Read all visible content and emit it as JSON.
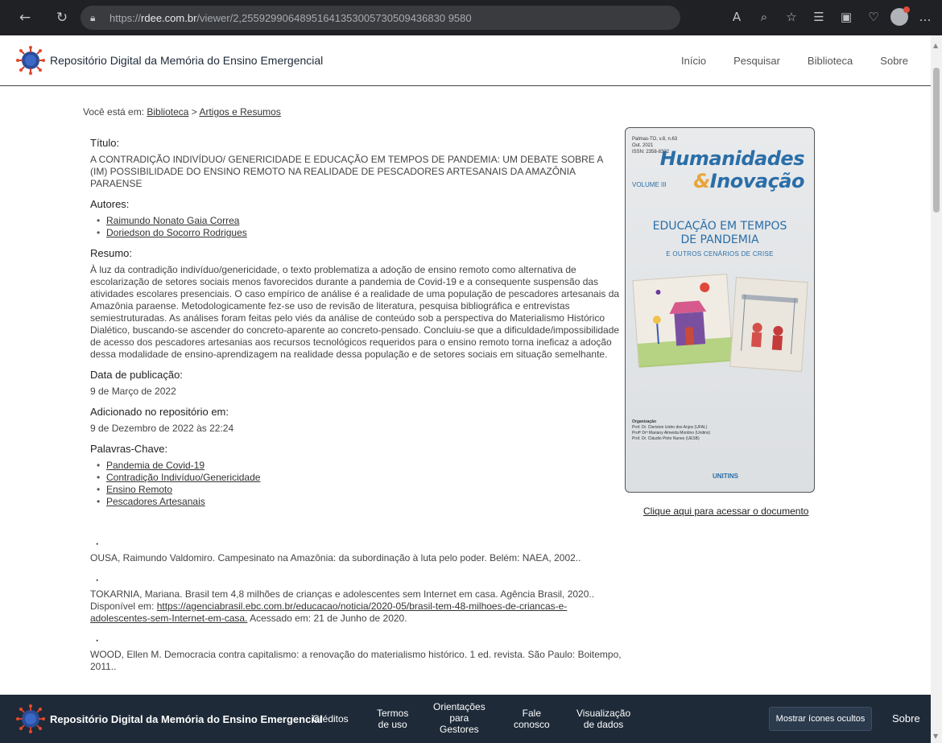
{
  "browser": {
    "url_prefix": "https://",
    "url_host": "rdee.com.br",
    "url_path": "/viewer/2,25592990648951641353005730509436830 9580"
  },
  "header": {
    "site_title": "Repositório Digital da Memória do Ensino Emergencial",
    "nav": [
      "Início",
      "Pesquisar",
      "Biblioteca",
      "Sobre"
    ]
  },
  "breadcrumb": {
    "prefix": "Você está em:",
    "biblioteca": "Biblioteca",
    "separator": ">",
    "current": "Artigos e Resumos"
  },
  "record": {
    "title_label": "Título:",
    "title": "A CONTRADIÇÃO INDIVÍDUO/ GENERICIDADE E EDUCAÇÃO EM TEMPOS DE PANDEMIA: UM DEBATE SOBRE A (IM) POSSIBILIDADE DO ENSINO REMOTO NA REALIDADE DE PESCADORES ARTESANAIS DA AMAZÔNIA PARAENSE",
    "authors_label": "Autores:",
    "authors": [
      "Raimundo Nonato Gaia Correa",
      "Doriedson do Socorro Rodrigues"
    ],
    "abstract_label": "Resumo:",
    "abstract": "À luz da contradição indivíduo/genericidade, o texto problematiza a adoção de ensino remoto como alternativa de escolarização de setores sociais menos favorecidos durante a pandemia de Covid-19 e a consequente suspensão das atividades escolares presenciais. O caso empírico de análise é a realidade de uma população de pescadores artesanais da Amazônia paraense. Metodologicamente fez-se uso de revisão de literatura, pesquisa bibliográfica e entrevistas semiestruturadas. As análises foram feitas pelo viés da análise de conteúdo sob a perspectiva do Materialismo Histórico Dialético, buscando-se ascender do concreto-aparente ao concreto-pensado. Concluiu-se que a dificuldade/impossibilidade de acesso dos pescadores artesanias aos recursos tecnológicos requeridos para o ensino remoto torna ineficaz a adoção dessa modalidade de ensino-aprendizagem na realidade dessa população e de setores sociais em situação semelhante.",
    "pubdate_label": "Data de publicação:",
    "pubdate": "9 de Março de 2022",
    "added_label": "Adicionado no repositório em:",
    "added": "9 de Dezembro de 2022 às 22:24",
    "keywords_label": "Palavras-Chave:",
    "keywords": [
      "Pandemia de Covid-19",
      "Contradição Indivíduo/Genericidade",
      "Ensino Remoto",
      "Pescadores Artesanais"
    ]
  },
  "references": {
    "ref1": "OUSA, Raimundo Valdomiro. Campesinato na Amazônia: da subordinação à luta pelo poder. Belém: NAEA, 2002..",
    "ref2_text": "TOKARNIA, Mariana. Brasil tem 4,8 milhões de crianças e adolescentes sem Internet em casa. Agência Brasil, 2020.. Disponível em:",
    "ref2_link": "https://agenciabrasil.ebc.com.br/educacao/noticia/2020-05/brasil-tem-48-milhoes-de-criancas-e-adolescentes-sem-Internet-em-casa.",
    "ref2_tail": "Acessado em: 21 de Junho de 2020.",
    "ref3": "WOOD, Ellen M. Democracia contra capitalismo: a renovação do materialismo histórico. 1 ed. revista. São Paulo: Boitempo, 2011.."
  },
  "cover": {
    "meta_line1": "Palmas-TO, v.8, n.63",
    "meta_line2": "Out. 2021",
    "meta_line3": "ISSN: 2358-8322",
    "brand1": "Humanidades",
    "brand2_amp": "&",
    "brand2": "Inovação",
    "volume": "VOLUME III",
    "heading1": "EDUCAÇÃO EM TEMPOS",
    "heading2": "DE PANDEMIA",
    "subheading": "E OUTROS CENÁRIOS DE CRISE",
    "org_label": "Organização",
    "org1": "Prof. Dr. Cleriston Izidro dos Anjos (UFAL)",
    "org2": "Profª Drª Mariany Almeida Montino (Unitins)",
    "org3": "Prof. Dr. Cláudio Pinto Nunes (UESB)",
    "publisher": "UNITINS",
    "access_link": "Clique aqui para acessar o documento"
  },
  "footer": {
    "title": "Repositório Digital da Memória do Ensino Emergencial",
    "creditos": "Créditos",
    "termos1": "Termos",
    "termos2": "de uso",
    "orient1": "Orientações",
    "orient2": "para",
    "orient3": "Gestores",
    "fale1": "Fale",
    "fale2": "conosco",
    "visual1": "Visualização",
    "visual2": "de dados",
    "show_icons": "Mostrar ícones ocultos",
    "sobre": "Sobre"
  },
  "colors": {
    "footer_bg": "#1e2a38",
    "cover_accent": "#2a6ea8"
  }
}
